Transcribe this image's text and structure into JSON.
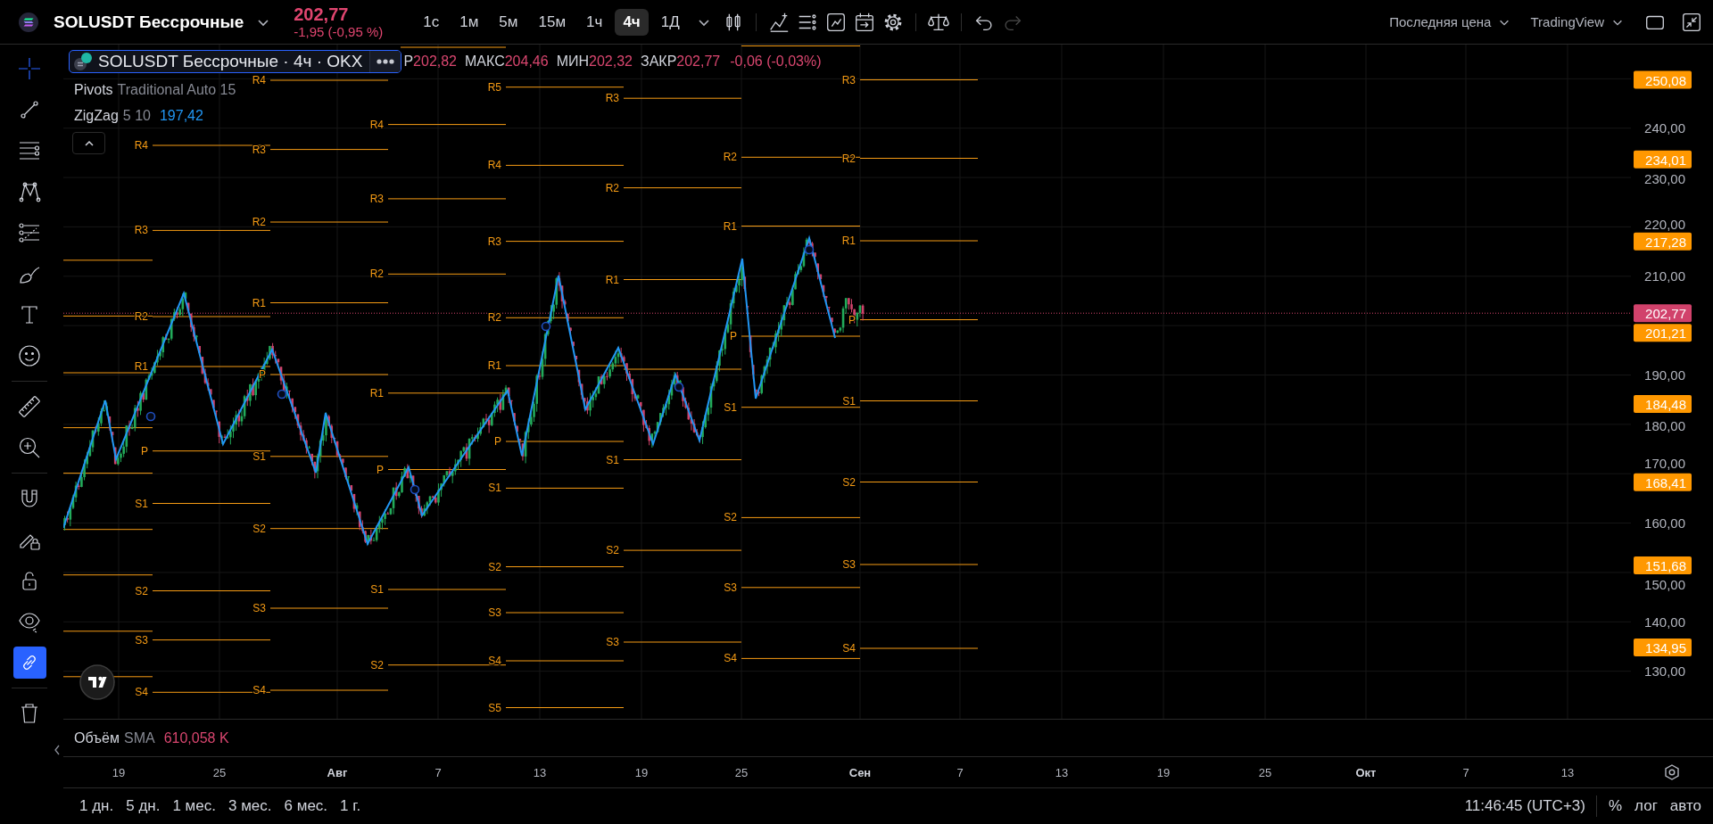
{
  "header": {
    "symbol": "SOLUSDT Бессрочные",
    "price": "202,77",
    "change": "-1,95 (-0,95 %)",
    "timeframes": [
      {
        "label": "1с",
        "selected": false
      },
      {
        "label": "1м",
        "selected": false
      },
      {
        "label": "5м",
        "selected": false
      },
      {
        "label": "15м",
        "selected": false
      },
      {
        "label": "1ч",
        "selected": false
      },
      {
        "label": "4ч",
        "selected": true
      },
      {
        "label": "1Д",
        "selected": false
      }
    ],
    "history": [
      {
        "disabled": false
      },
      {
        "disabled": true
      }
    ],
    "price_source": "Последняя цена",
    "provider": "TradingView"
  },
  "left_toolbar": {
    "drawing_tools": [
      {
        "selected": true
      },
      {
        "selected": false
      },
      {
        "selected": false
      },
      {
        "selected": false
      },
      {
        "selected": false
      },
      {
        "selected": false
      },
      {
        "selected": false
      },
      {
        "selected": false
      },
      {
        "selected": false
      },
      {
        "selected": false
      }
    ],
    "toggles": [
      {
        "on": false
      },
      {
        "on": false
      },
      {
        "on": false
      },
      {
        "on": false
      },
      {
        "on": true
      }
    ]
  },
  "legend": {
    "title": "SOLUSDT Бессрочные · 4ч · OKX",
    "ohlc": [
      {
        "label": "Р",
        "value": "202,82"
      },
      {
        "label": "МАКС",
        "value": "204,46"
      },
      {
        "label": "МИН",
        "value": "202,32"
      },
      {
        "label": "ЗАКР",
        "value": "202,77"
      }
    ],
    "change": "-0,06 (-0,03%)",
    "indicators": [
      {
        "name": "Pivots",
        "params": "Traditional Auto 15"
      },
      {
        "name": "ZigZag",
        "params": "5 10",
        "value": "197,42"
      }
    ]
  },
  "chart": {
    "pivot_periods": [
      {
        "labels": [
          "R4",
          "R3",
          "R2",
          "R1",
          "P",
          "S1",
          "S2",
          "S3",
          "S4"
        ]
      },
      {
        "labels": [
          "R4",
          "R3",
          "R2",
          "R1",
          "P",
          "S1",
          "S2",
          "S3",
          "S4"
        ]
      },
      {
        "labels": [
          "R4",
          "R3",
          "R2",
          "R1",
          "P",
          "S1",
          "S2"
        ]
      },
      {
        "labels": [
          "R5",
          "R4",
          "R3",
          "R2",
          "R1",
          "P",
          "S1",
          "S2",
          "S3",
          "S4",
          "S5"
        ]
      },
      {
        "labels": [
          "R3",
          "R2",
          "R1",
          "S1",
          "S2",
          "S3"
        ]
      },
      {
        "labels": [
          "R2",
          "R1",
          "P",
          "S1",
          "S2",
          "S3",
          "S4"
        ]
      },
      {
        "labels": [
          "R3",
          "R2",
          "R1",
          "P",
          "S1",
          "S2",
          "S3",
          "S4"
        ]
      }
    ],
    "price_ticks": [
      "240,00",
      "230,00",
      "220,00",
      "210,00",
      "190,00",
      "180,00",
      "170,00",
      "160,00",
      "150,00",
      "140,00",
      "130,00"
    ],
    "level_badges": [
      "250,08",
      "234,01",
      "217,28",
      "201,21",
      "184,48",
      "168,41",
      "151,68",
      "134,95"
    ],
    "last_price": "202,77"
  },
  "volume": {
    "name": "Объём",
    "ma": "SMA",
    "value": "610,058 K"
  },
  "time_axis": [
    {
      "label": "19",
      "kind": "day"
    },
    {
      "label": "25",
      "kind": "day"
    },
    {
      "label": "Авг",
      "kind": "month"
    },
    {
      "label": "7",
      "kind": "day"
    },
    {
      "label": "13",
      "kind": "day"
    },
    {
      "label": "19",
      "kind": "day"
    },
    {
      "label": "25",
      "kind": "day"
    },
    {
      "label": "Сен",
      "kind": "month"
    },
    {
      "label": "7",
      "kind": "day"
    },
    {
      "label": "13",
      "kind": "day"
    },
    {
      "label": "19",
      "kind": "day"
    },
    {
      "label": "25",
      "kind": "day"
    },
    {
      "label": "Окт",
      "kind": "month"
    },
    {
      "label": "7",
      "kind": "day"
    },
    {
      "label": "13",
      "kind": "day"
    }
  ],
  "bottom_bar": {
    "ranges": [
      "1 дн.",
      "5 дн.",
      "1 мес.",
      "3 мес.",
      "6 мес.",
      "1 г."
    ],
    "clock": "11:46:45 (UTC+3)",
    "percent": "%",
    "log": "лог",
    "auto": "авто"
  }
}
